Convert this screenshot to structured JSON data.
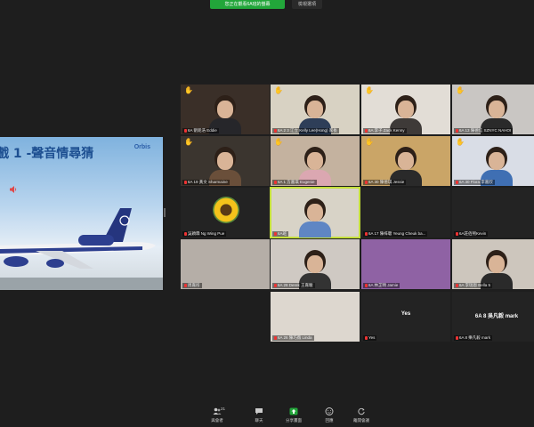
{
  "topbar": {
    "share_label": "您正在觀看6A班的螢幕",
    "view_options": "檢視選項"
  },
  "slide": {
    "title": "戲 1 -聲音情尋猜",
    "brand": "Orbis"
  },
  "participants": [
    {
      "name": "6A 劉銘浩 Eddie",
      "hand": true
    },
    {
      "name": "6A 2 3 江立 Kelly Lee(Hong) 家長",
      "hand": true
    },
    {
      "name": "6A 李子 Zack Kenny",
      "hand": true
    },
    {
      "name": "6A 13 陳德信 SZNYC NAHOI",
      "hand": true
    },
    {
      "name": "6A 19 黃文 Sharmaine",
      "hand": true
    },
    {
      "name": "6A 1 方嘉琪 Eugenie",
      "hand": true
    },
    {
      "name": "6A 30 陳德琪 Jessie",
      "hand": true
    },
    {
      "name": "6A 30 Flora 李嘉欣",
      "hand": true
    },
    {
      "name": "吳穎霖 Ng Wing Pue",
      "hand": false
    },
    {
      "name": "6A班",
      "hand": false
    },
    {
      "name": "6A 17 陳梓聰 Yeung Cheuk ba...",
      "hand": false
    },
    {
      "name": "6A莊佰熙Kevin",
      "hand": false
    },
    {
      "name": "周嘉彤",
      "hand": false
    },
    {
      "name": "6A 28 Derek 王嘉駿",
      "hand": false
    },
    {
      "name": "6A 林芷晴 Jamie",
      "hand": false
    },
    {
      "name": "6A 李瑞恩 Bella 5",
      "hand": false
    },
    {
      "name": "6A 26 陳巧薇 Linda",
      "hand": false
    },
    {
      "name": "Yes",
      "hand": false,
      "big": "Yes"
    },
    {
      "name": "6A 8 樂凡毅 mark",
      "hand": false,
      "big": "6A 8 吳凡毅 mark"
    }
  ],
  "toolbar": {
    "participants": {
      "label": "與會者",
      "count": "21"
    },
    "chat": {
      "label": "聊天"
    },
    "share": {
      "label": "分享畫面"
    },
    "record": {
      "label": "回應"
    },
    "leave": {
      "label": "離開會議"
    }
  },
  "colors": {
    "share_green": "#22a63a",
    "active_speaker": "#c4e03a",
    "raised_hand": "#f2b632",
    "muted_red": "#ee3333"
  }
}
